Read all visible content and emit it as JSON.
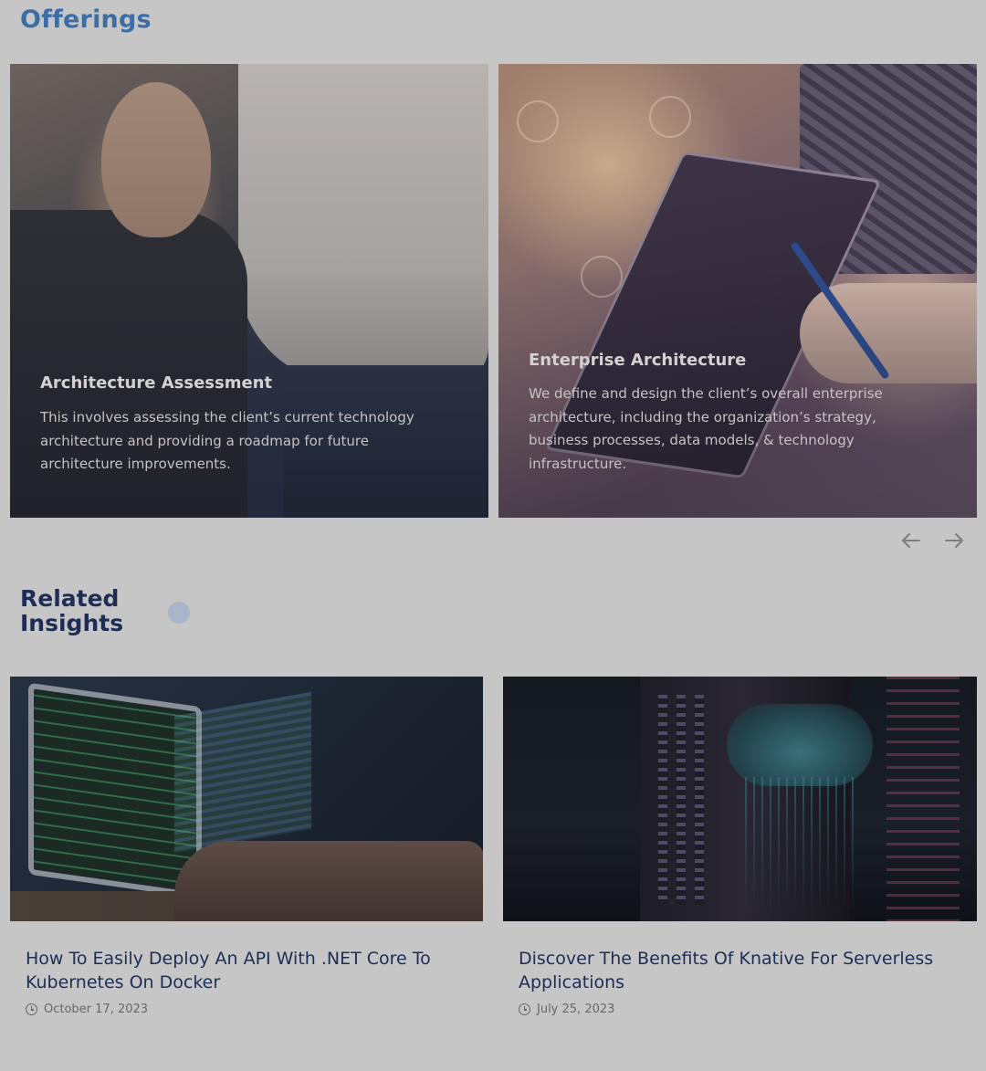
{
  "offerings": {
    "title": "Offerings",
    "cards": [
      {
        "title": "Architecture Assessment",
        "description": "This involves assessing the client’s current technology architecture and providing a roadmap for future architecture improvements."
      },
      {
        "title": "Enterprise Architecture",
        "description": "We define and design the client’s overall enterprise architecture, including the organization’s strategy, business processes, data models, & technology infrastructure."
      }
    ],
    "nav": {
      "prev_icon": "arrow-left-icon",
      "next_icon": "arrow-right-icon"
    }
  },
  "insights": {
    "title_line1": "Related",
    "title_line2": "Insights",
    "posts": [
      {
        "title": "How To Easily Deploy An API With .NET Core To Kubernetes On Docker",
        "date": "October 17, 2023",
        "date_icon": "clock-icon"
      },
      {
        "title": "Discover The Benefits Of Knative For Serverless Applications",
        "date": "July 25, 2023",
        "date_icon": "clock-icon"
      }
    ]
  },
  "colors": {
    "background": "#c6c6c6",
    "heading_blue": "#3b6ea5",
    "navy": "#1e2d55"
  }
}
